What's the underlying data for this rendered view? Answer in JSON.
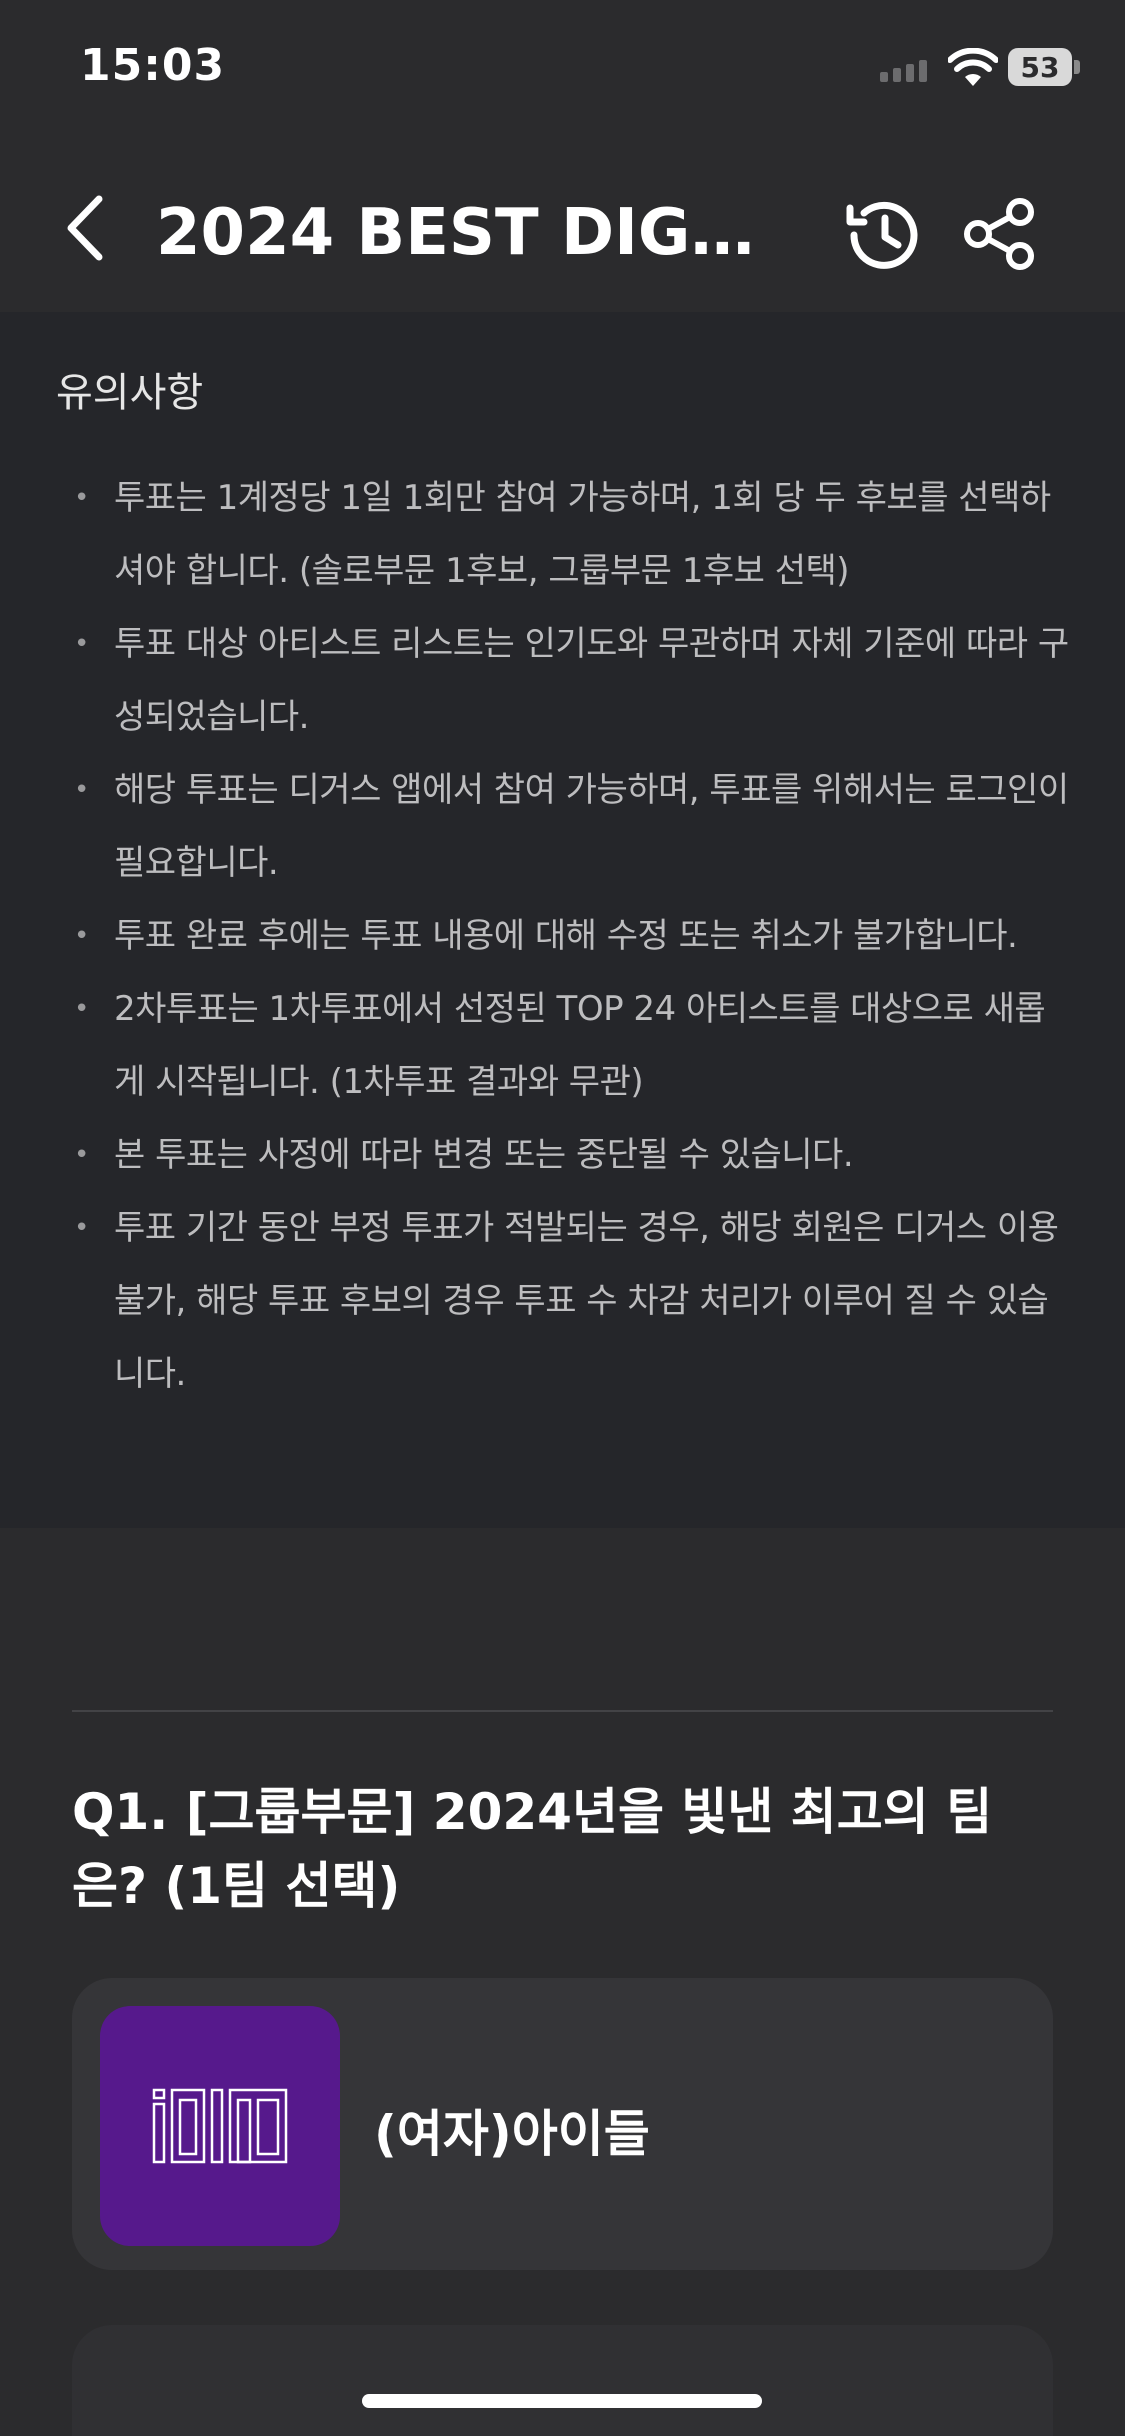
{
  "status_bar": {
    "time": "15:03",
    "battery": "53"
  },
  "header": {
    "title": "2024 BEST DIG...",
    "back_icon": "chevron-left-icon",
    "history_icon": "history-icon",
    "share_icon": "share-icon"
  },
  "notice": {
    "title": "유의사항",
    "items": [
      "투표는 1계정당 1일 1회만 참여 가능하며, 1회 당 두 후보를 선택하셔야 합니다. (솔로부문 1후보, 그룹부문 1후보 선택)",
      "투표 대상 아티스트 리스트는 인기도와 무관하며 자체 기준에 따라 구성되었습니다.",
      "해당 투표는 디거스 앱에서 참여 가능하며, 투표를 위해서는 로그인이 필요합니다.",
      "투표 완료 후에는 투표 내용에 대해 수정 또는 취소가 불가합니다.",
      "2차투표는 1차투표에서 선정된 TOP 24 아티스트를 대상으로 새롭게 시작됩니다. (1차투표 결과와 무관)",
      "본 투표는 사정에 따라 변경 또는 중단될 수 있습니다.",
      "투표 기간 동안 부정 투표가 적발되는 경우, 해당 회원은 디거스 이용 불가, 해당 투표 후보의 경우 투표 수 차감 처리가 이루어 질 수 있습니다."
    ]
  },
  "question": {
    "title": "Q1. [그룹부문] 2024년을 빛낸 최고의 팀은? (1팀 선택)",
    "options": [
      {
        "name": "(여자)아이들",
        "logo_text": "idle",
        "logo_color": "#56198c"
      }
    ]
  }
}
